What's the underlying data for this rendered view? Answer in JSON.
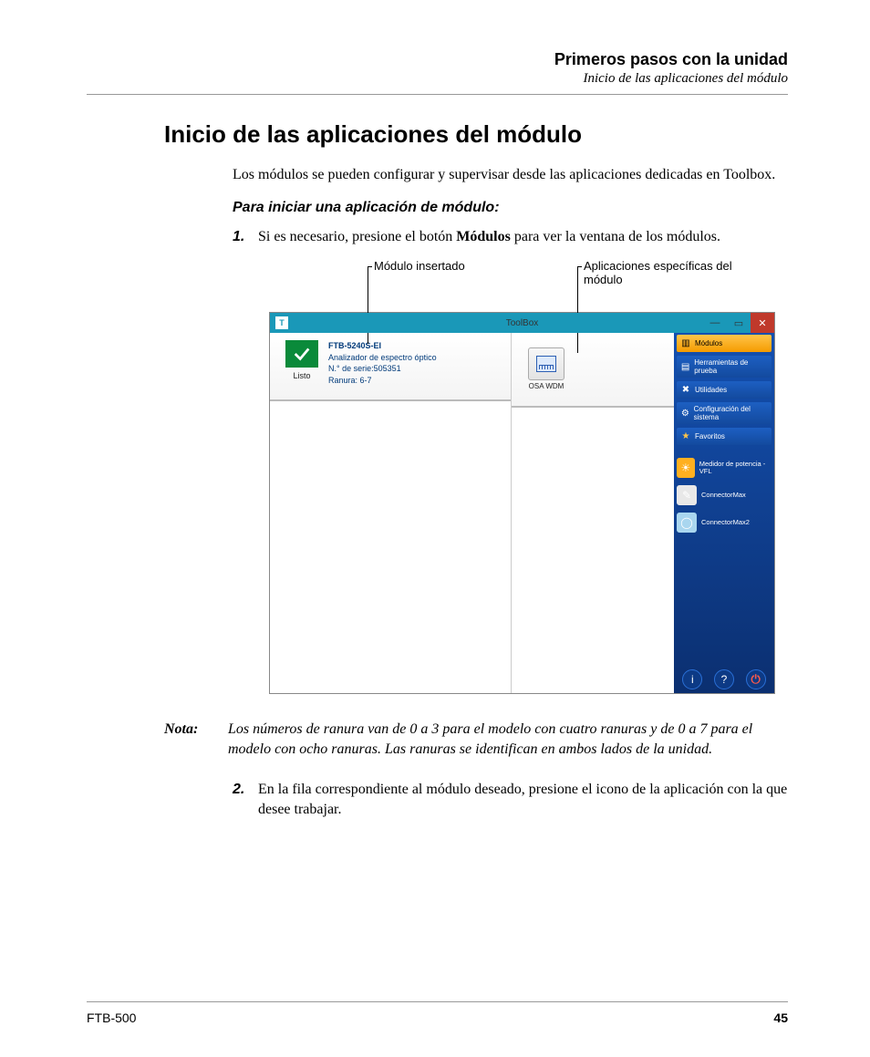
{
  "header": {
    "line1": "Primeros pasos con la unidad",
    "line2": "Inicio de las aplicaciones del módulo"
  },
  "section_title": "Inicio de las aplicaciones del módulo",
  "intro": "Los módulos se pueden configurar y supervisar desde las aplicaciones dedicadas en Toolbox.",
  "subhead": "Para iniciar una aplicación de módulo:",
  "step1_num": "1.",
  "step1_pre": "Si es necesario, presione el botón ",
  "step1_bold": "Módulos",
  "step1_post": " para ver la ventana de los módulos.",
  "callout_left": "Módulo insertado",
  "callout_right": "Aplicaciones específicas del módulo",
  "toolbox": {
    "title": "ToolBox",
    "win_min": "—",
    "win_max": "▭",
    "win_close": "✕",
    "status_label": "Listo",
    "module": {
      "name": "FTB-5240S-EI",
      "desc": "Analizador de espectro óptico",
      "serial": "N.° de serie:505351",
      "slot": "Ranura: 6-7"
    },
    "app_name": "OSA WDM",
    "sidebar": {
      "modulos": "Módulos",
      "herr": "Herramientas de prueba",
      "util": "Utilidades",
      "config": "Configuración del sistema",
      "fav": "Favoritos",
      "app1": "Medidor de potencia - VFL",
      "app2": "ConnectorMax",
      "app3": "ConnectorMax2",
      "info": "i",
      "help": "?",
      "power": "⏻"
    }
  },
  "note_label": "Nota:",
  "note_text": "Los números de ranura van de 0 a 3 para el modelo con cuatro ranuras y de 0 a 7 para el modelo con ocho ranuras. Las ranuras se identifican en ambos lados de la unidad.",
  "step2_num": "2.",
  "step2_text": "En la fila correspondiente al módulo deseado, presione el icono de la aplicación con la que desee trabajar.",
  "footer": {
    "model": "FTB-500",
    "page": "45"
  }
}
